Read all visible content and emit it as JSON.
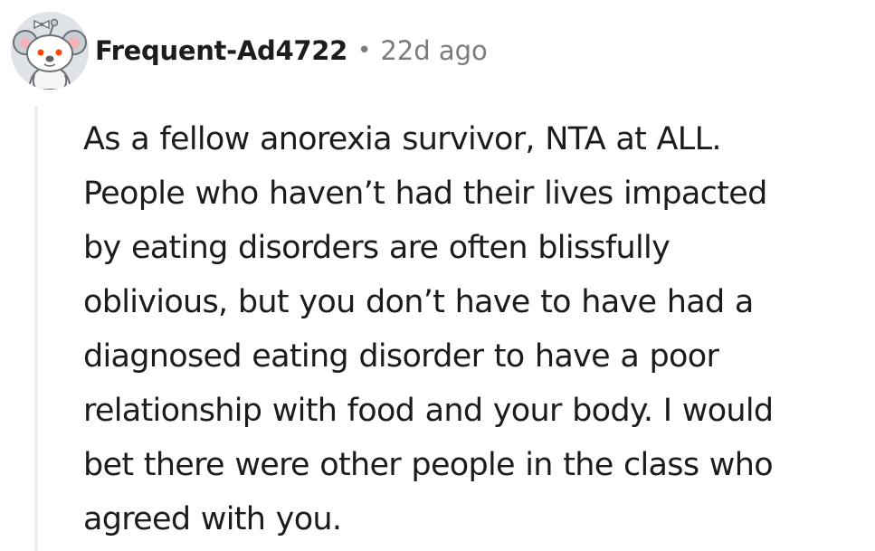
{
  "comment": {
    "author": "Frequent-Ad4722",
    "separator": "•",
    "timestamp": "22d ago",
    "avatar_icon": "koala-snoo-avatar-icon",
    "body_lines": [
      "As a fellow anorexia survivor, NTA at ALL.",
      "People who haven’t had their lives impacted",
      "by eating disorders are often blissfully",
      "oblivious, but you don’t have to have had a",
      "diagnosed eating disorder to have a poor",
      "relationship with food and your body. I would",
      "bet there were other people in the class who",
      "agreed with you."
    ]
  },
  "colors": {
    "text": "#1c1c1c",
    "meta": "#7c7c7c",
    "thread_line": "#ededed",
    "avatar_bg": "#dfe3e7"
  }
}
